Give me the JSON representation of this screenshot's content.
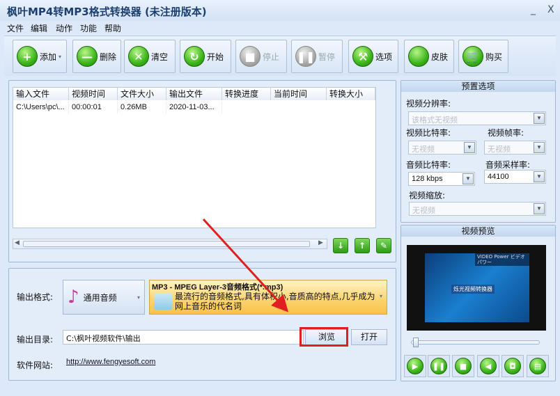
{
  "window": {
    "title": "枫叶MP4转MP3格式转换器  (未注册版本)",
    "minimize": "_",
    "close": "X"
  },
  "menu": [
    "文件",
    "编辑",
    "动作",
    "功能",
    "帮助"
  ],
  "toolbar": [
    {
      "label": "添加",
      "icon": "plus",
      "dropdown": "▾"
    },
    {
      "label": "删除",
      "icon": "minus"
    },
    {
      "label": "清空",
      "icon": "x"
    },
    {
      "label": "开始",
      "icon": "refresh"
    },
    {
      "label": "停止",
      "icon": "stop",
      "disabled": true
    },
    {
      "label": "暂停",
      "icon": "pause",
      "disabled": true
    },
    {
      "label": "选项",
      "icon": "tools"
    },
    {
      "label": "皮肤",
      "icon": "apple"
    },
    {
      "label": "购买",
      "icon": "cart"
    }
  ],
  "table": {
    "columns": [
      "输入文件",
      "视频时间",
      "文件大小",
      "输出文件",
      "转换进度",
      "当前时间",
      "转换大小"
    ],
    "rows": [
      [
        "C:\\Users\\pc\\...",
        "00:00:01",
        "0.26MB",
        "2020-11-03...",
        "",
        "",
        ""
      ]
    ]
  },
  "output": {
    "format_label": "输出格式:",
    "category": "通用音频",
    "format_title": "MP3 - MPEG Layer-3音频格式(*.mp3)",
    "format_desc": "最流行的音频格式,具有体积小,音质高的特点,几乎成为网上音乐的代名词",
    "dir_label": "输出目录:",
    "dir_value": "C:\\枫叶视频软件\\输出",
    "browse": "浏览",
    "open": "打开",
    "site_label": "软件网站:",
    "site_url": "http://www.fengyesoft.com"
  },
  "preset": {
    "title": "预置选项",
    "resolution_label": "视频分辨率:",
    "resolution": "该格式无视频",
    "vbitrate_label": "视频比特率:",
    "vbitrate": "无视频",
    "fps_label": "视频帧率:",
    "fps": "无视频",
    "abitrate_label": "音频比特率:",
    "abitrate": "128 kbps",
    "samplerate_label": "音频采样率:",
    "samplerate": "44100",
    "scale_label": "视频缩放:",
    "scale": "无视频"
  },
  "preview": {
    "title": "视频预览",
    "overlay_brand": "VIDEO Power ビデオパワー",
    "overlay_text": "烁光视频转换器",
    "position": 0.05
  },
  "colors": {
    "accent": "#3cb51b",
    "highlight": "#e02020"
  }
}
